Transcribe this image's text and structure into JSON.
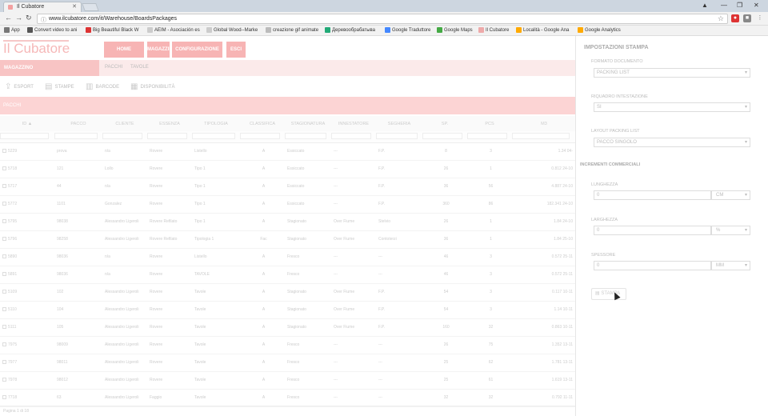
{
  "browser": {
    "tab_title": "Il Cubatore",
    "url": "www.ilcubatore.com/it/Warehouse/BoardsPackages",
    "bookmarks": [
      {
        "label": "App",
        "color": "#444"
      },
      {
        "label": "Convert video to ani",
        "color": "#555"
      },
      {
        "label": "Big Beautiful Black W",
        "color": "#d33"
      },
      {
        "label": "AEIM - Asociación es",
        "color": "#888"
      },
      {
        "label": "Global Wood--Marke",
        "color": "#888"
      },
      {
        "label": "creazione gif animate",
        "color": "#aaa"
      },
      {
        "label": "Деревообрабатыва",
        "color": "#2a7"
      },
      {
        "label": "Google Traduttore",
        "color": "#48f"
      },
      {
        "label": "Google Maps",
        "color": "#4a4"
      },
      {
        "label": "Il Cubatore",
        "color": "#eaa"
      },
      {
        "label": "Località - Google Ana",
        "color": "#fa0"
      },
      {
        "label": "Google Analytics",
        "color": "#fa0"
      }
    ]
  },
  "app": {
    "logo": "Il Cubatore",
    "nav": [
      "HOME",
      "MAGAZZINO",
      "CONFIGURAZIONE",
      "ESCI"
    ],
    "subnav_active": "MAGAZZINO",
    "subnav_items": [
      "PACCHI",
      "TAVOLE"
    ],
    "toolbar": [
      "ESPORT",
      "STAMPE",
      "BARCODE",
      "DISPONIBILITÀ"
    ],
    "panel_title": "PACCHI",
    "columns": [
      "ID ▲",
      "PACCO",
      "CLIENTE",
      "ESSENZA",
      "TIPOLOGIA",
      "CLASSIFICA",
      "STAGIONATURA",
      "INNESTATORE",
      "SEGHERIA",
      "SP.",
      "PCS",
      "M3"
    ],
    "rows": [
      [
        "5229",
        "prova",
        "n/a",
        "Rovere",
        "Listello",
        "A",
        "Essiccato",
        "---",
        "F.P.",
        "8",
        "3",
        "1.34 04-"
      ],
      [
        "5718",
        "121",
        "Lollo",
        "Rovere",
        "Tipo 1",
        "A",
        "Essiccato",
        "---",
        "F.P.",
        "26",
        "1",
        "0.812 24-10"
      ],
      [
        "5717",
        "44",
        "n/a",
        "Rovere",
        "Tipo 1",
        "A",
        "Essiccato",
        "---",
        "F.P.",
        "36",
        "56",
        "4.887 24-10"
      ],
      [
        "5772",
        "1101",
        "Gonzalez",
        "Rovere",
        "Tipo 1",
        "A",
        "Essiccato",
        "---",
        "F.P.",
        "360",
        "86",
        "182.341 24-10"
      ],
      [
        "5795",
        "98038",
        "Alessandro Ligeroli",
        "Rovere Refilato",
        "Tipo 1",
        "A",
        "Stagionato",
        "Over Fiume",
        "Stelvio",
        "26",
        "1",
        "1.84 24-10"
      ],
      [
        "5796",
        "98258",
        "Alessandro Ligeroli",
        "Rovere Refilato",
        "Tipologia 1",
        "Fac",
        "Stagionato",
        "Over Fiume",
        "Contoterzi",
        "36",
        "1",
        "1.84 25-10"
      ],
      [
        "5890",
        "98036",
        "n/a",
        "Rovere",
        "Listello",
        "A",
        "Fresco",
        "---",
        "---",
        "46",
        "3",
        "0.572 25-11"
      ],
      [
        "5891",
        "98036",
        "n/a",
        "Rovere",
        "TAVOLE",
        "A",
        "Fresco",
        "---",
        "---",
        "46",
        "3",
        "0.572 25-11"
      ],
      [
        "5109",
        "102",
        "Alessandro Ligeroli",
        "Rovere",
        "Tavole",
        "A",
        "Stagionato",
        "Over Fiume",
        "F.P.",
        "54",
        "3",
        "0.117 10-11"
      ],
      [
        "5110",
        "104",
        "Alessandro Ligeroli",
        "Rovere",
        "Tavole",
        "A",
        "Stagionato",
        "Over Fiume",
        "F.P.",
        "54",
        "3",
        "1.14 10-11"
      ],
      [
        "5111",
        "105",
        "Alessandro Ligeroli",
        "Rovere",
        "Tavole",
        "A",
        "Stagionato",
        "Over Fiume",
        "F.P.",
        "160",
        "32",
        "0.863 10-11"
      ],
      [
        "7975",
        "98009",
        "Alessandro Ligeroli",
        "Rovere",
        "Tavole",
        "A",
        "Fresco",
        "---",
        "---",
        "26",
        "75",
        "1.352 13-11"
      ],
      [
        "7977",
        "98011",
        "Alessandro Ligeroli",
        "Rovere",
        "Tavole",
        "A",
        "Fresco",
        "---",
        "---",
        "25",
        "62",
        "1.781 13-11"
      ],
      [
        "7978",
        "98012",
        "Alessandro Ligeroli",
        "Rovere",
        "Tavole",
        "A",
        "Fresco",
        "---",
        "---",
        "25",
        "61",
        "1.619 13-11"
      ],
      [
        "7718",
        "63",
        "Alessandro Ligeroli",
        "Faggio",
        "Tavole",
        "A",
        "Fresco",
        "---",
        "---",
        "32",
        "32",
        "0.792 11-11"
      ]
    ],
    "footer": "Pagina 1 di 18"
  },
  "side": {
    "title": "IMPOSTAZIONI STAMPA",
    "format_label": "FORMATO DOCUMENTO",
    "format_value": "PACKING LIST",
    "header_label": "RIQUADRO INTESTAZIONE",
    "header_value": "SI",
    "layout_label": "LAYOUT PACKING LIST",
    "layout_value": "PACCO SINGOLO",
    "section": "INCREMENTI COMMERCIALI",
    "length_label": "LUNGHEZZA",
    "length_value": "0",
    "length_unit": "CM",
    "width_label": "LARGHEZZA",
    "width_value": "0",
    "width_unit": "%",
    "thick_label": "SPESSORE",
    "thick_value": "0",
    "thick_unit": "MM",
    "print_label": "STAMPA"
  }
}
